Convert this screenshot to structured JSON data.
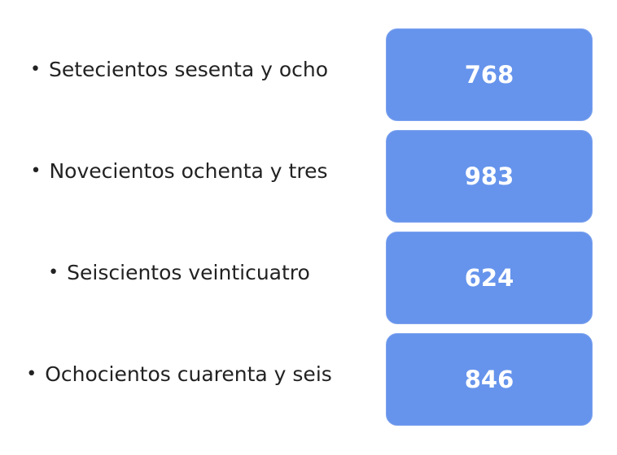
{
  "bullet": "•",
  "items": [
    {
      "label": "Setecientos sesenta y ocho",
      "value": "768"
    },
    {
      "label": "Novecientos ochenta y tres",
      "value": "983"
    },
    {
      "label": "Seiscientos veinticuatro",
      "value": "624"
    },
    {
      "label": "Ochocientos cuarenta y seis",
      "value": "846"
    }
  ],
  "colors": {
    "box": "#6694ec",
    "box_text": "#ffffff",
    "label_text": "#222222"
  }
}
